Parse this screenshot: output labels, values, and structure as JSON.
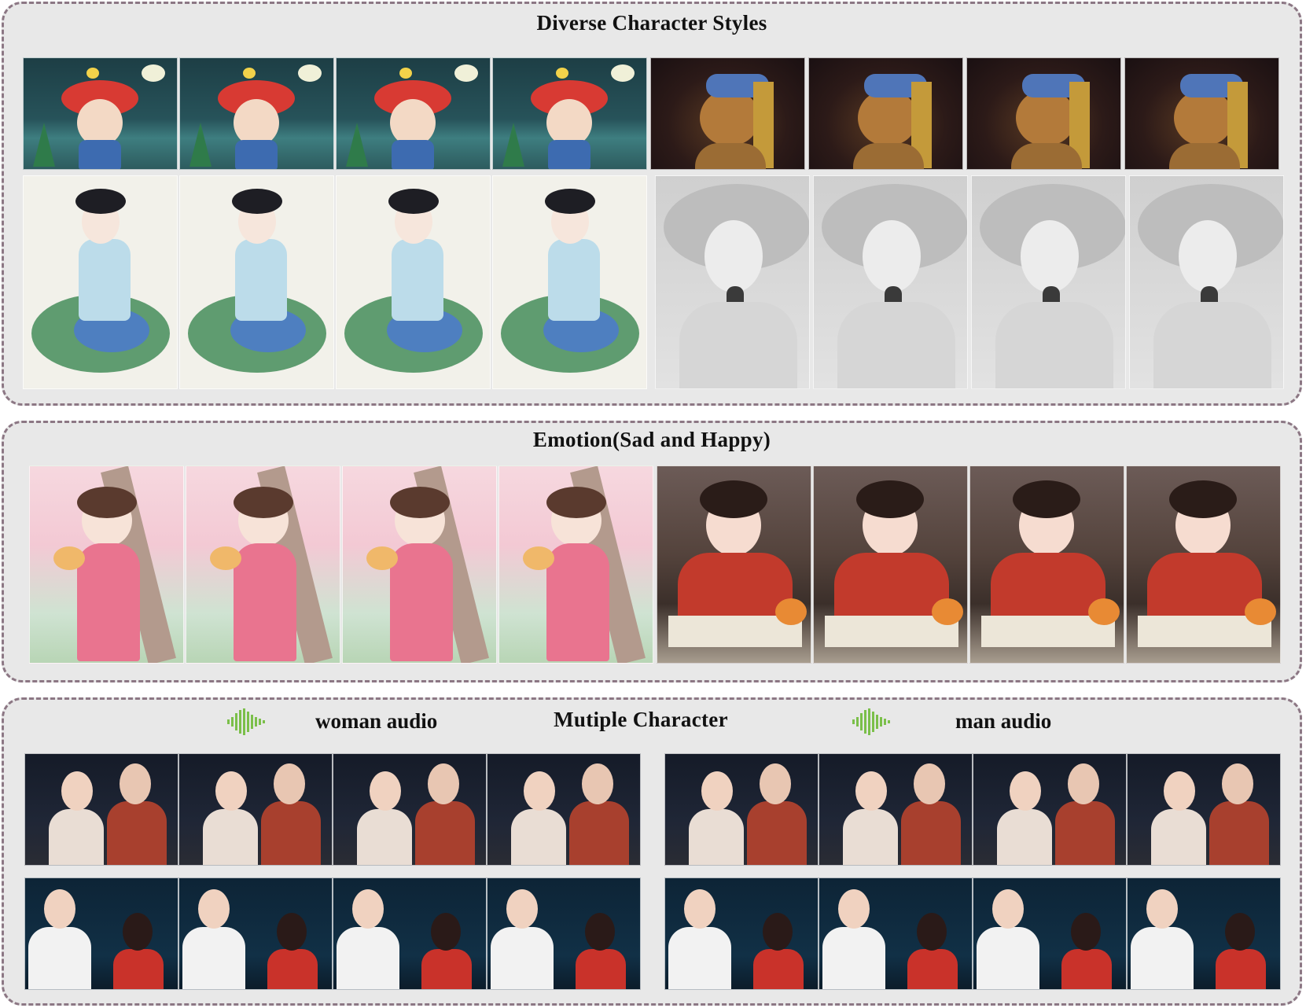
{
  "panels": {
    "styles": {
      "title": "Diverse Character Styles"
    },
    "emotion": {
      "title": "Emotion(Sad and Happy)"
    },
    "multi": {
      "title": "Mutiple Character",
      "left_audio_label": "woman audio",
      "right_audio_label": "man audio",
      "audio_icon": "sound-wave-icon",
      "audio_icon_color": "#7bbf4a"
    }
  },
  "colors": {
    "panel_bg": "#e8e8e8",
    "panel_border": "#8c7784",
    "title_text": "#111111"
  }
}
